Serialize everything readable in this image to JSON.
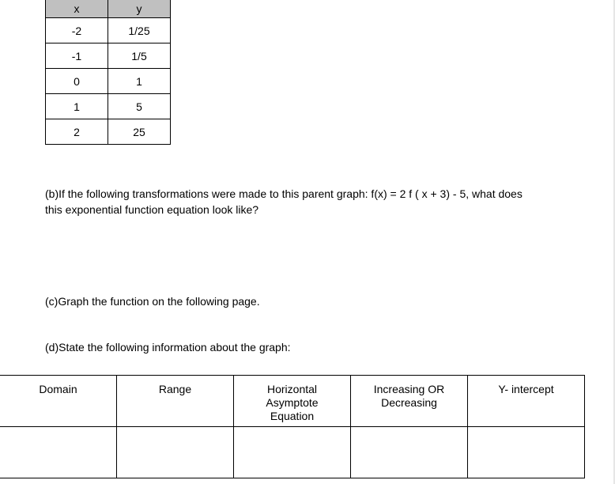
{
  "values_table": {
    "headers": [
      "x",
      "y"
    ],
    "rows": [
      [
        "-2",
        "1/25"
      ],
      [
        "-1",
        "1/5"
      ],
      [
        "0",
        "1"
      ],
      [
        "1",
        "5"
      ],
      [
        "2",
        "25"
      ]
    ]
  },
  "questions": {
    "b": "(b)If the following transformations were made to this parent graph: f(x) = 2 f ( x + 3) - 5, what does this exponential function equation look like?",
    "c": "(c)Graph the function on the following page.",
    "d": "(d)State the following information about the graph:"
  },
  "info_table": {
    "headers": [
      "Domain",
      "Range",
      "Horizontal Asymptote Equation",
      "Increasing OR Decreasing",
      "Y- intercept"
    ],
    "answers": [
      "",
      "",
      "",
      "",
      ""
    ]
  },
  "colors": {
    "header_fill": "#c0c0c0",
    "border": "#000000"
  }
}
